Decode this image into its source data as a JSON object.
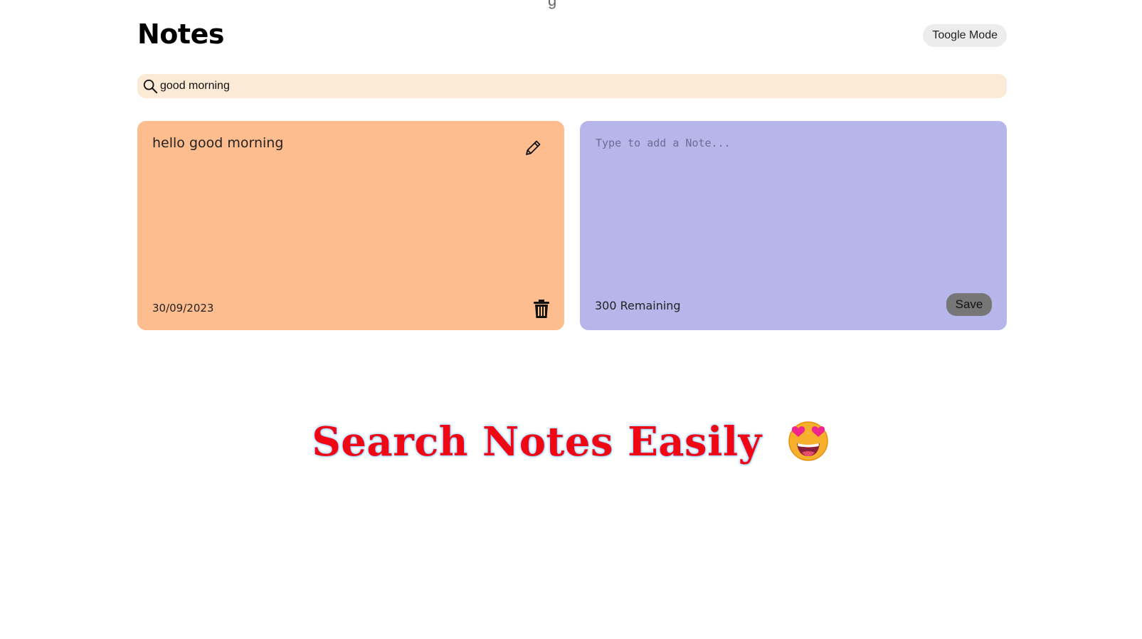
{
  "header": {
    "title": "Notes",
    "toggle_label": "Toogle Mode"
  },
  "search": {
    "value": "good morning",
    "icon": "search-icon"
  },
  "notes": [
    {
      "text": "hello good morning",
      "date": "30/09/2023"
    }
  ],
  "new_note": {
    "placeholder": "Type to add a Note...",
    "remaining": "300 Remaining",
    "save_label": "Save"
  },
  "caption": {
    "text": "Search Notes Easily"
  },
  "colors": {
    "search_bg": "#fbead5",
    "note_existing_bg": "#fdbd8f",
    "note_new_bg": "#b7b6ea",
    "caption_color": "#f00714",
    "save_bg": "#767676"
  }
}
